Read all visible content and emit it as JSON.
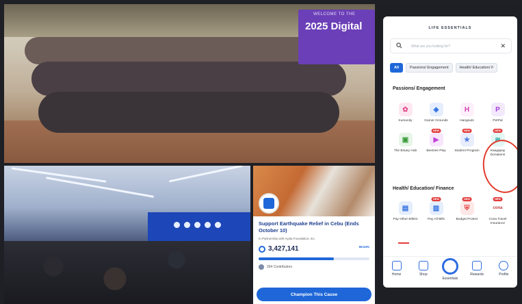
{
  "group_photo": {
    "banner_small": "WELCOME TO THE",
    "banner_text": "2025 Digital"
  },
  "campaign": {
    "title": "Support Earthquake Relief in Cebu (Ends October 10)",
    "subtitle": "In Partnership with Ayala Foundation, Inc.",
    "amount": "3,427,141",
    "percent_text": "68.54%",
    "progress": 0.68,
    "donors": "264 Contributors",
    "button_label": "Champion This Cause"
  },
  "app": {
    "title": "LIFE ESSENTIALS",
    "search": {
      "placeholder": "What are you looking for?",
      "close_glyph": "✕"
    },
    "chips": [
      {
        "label": "All",
        "active": true
      },
      {
        "label": "Passions/ Engagement",
        "active": false
      },
      {
        "label": "Health/ Education/ F",
        "active": false
      }
    ],
    "sections": [
      {
        "title": "Passions/ Engagement",
        "items": [
          {
            "label": "Kumunity",
            "glyph": "✿",
            "color": "#e24a8a",
            "bg": "#fde8f1",
            "icon": "kumunity-icon",
            "badge": ""
          },
          {
            "label": "Gamer Grounds",
            "glyph": "◈",
            "color": "#2e6ee0",
            "bg": "#e5eefc",
            "icon": "gamer-grounds-icon",
            "badge": ""
          },
          {
            "label": "Hangouts",
            "glyph": "H",
            "color": "#d23fb0",
            "bg": "#fdf0fa",
            "icon": "hangouts-icon",
            "badge": ""
          },
          {
            "label": "PetPal",
            "glyph": "P",
            "color": "#a33dd9",
            "bg": "#f3e9fc",
            "icon": "petpal-icon",
            "badge": ""
          },
          {
            "label": "The Binary Hub",
            "glyph": "▣",
            "color": "#3a9a3a",
            "bg": "#e7f6e7",
            "icon": "binary-hub-icon",
            "badge": ""
          },
          {
            "label": "Beetzee Play",
            "glyph": "▶",
            "color": "#c040d6",
            "bg": "#f7e6fb",
            "icon": "beetzee-play-icon",
            "badge": "NEW"
          },
          {
            "label": "Student Program",
            "glyph": "★",
            "color": "#4b7be0",
            "bg": "#e8eefb",
            "icon": "student-program-icon",
            "badge": "NEW"
          },
          {
            "label": "Kaagapay Donations",
            "glyph": "≋",
            "color": "#2aa7a0",
            "bg": "#e2f6f4",
            "icon": "kaagapay-donations-icon",
            "badge": "NEW"
          }
        ]
      },
      {
        "title": "Health/ Education/ Finance",
        "items": [
          {
            "label": "Pay Other Billers",
            "glyph": "▤",
            "color": "#2e6ee0",
            "bg": "#e5eefc",
            "icon": "pay-billers-icon",
            "badge": ""
          },
          {
            "label": "Pay All Bills",
            "glyph": "▥",
            "color": "#2e6ee0",
            "bg": "#e5eefc",
            "icon": "pay-all-bills-icon",
            "badge": "NEW"
          },
          {
            "label": "Budget Protect",
            "glyph": "⛨",
            "color": "#e23b3b",
            "bg": "#fde7e7",
            "icon": "budget-protect-icon",
            "badge": "NEW"
          },
          {
            "label": "Cona Travel Insurance",
            "glyph": "cona",
            "color": "#c03a3a",
            "bg": "#ffffff",
            "icon": "cona-icon",
            "badge": "NEW"
          }
        ]
      }
    ],
    "nav": [
      {
        "label": "Home",
        "icon": "home-icon"
      },
      {
        "label": "Shop",
        "icon": "shop-icon"
      },
      {
        "label": "Essentials",
        "icon": "essentials-icon"
      },
      {
        "label": "Rewards",
        "icon": "rewards-icon"
      },
      {
        "label": "Profile",
        "icon": "profile-icon"
      }
    ]
  }
}
